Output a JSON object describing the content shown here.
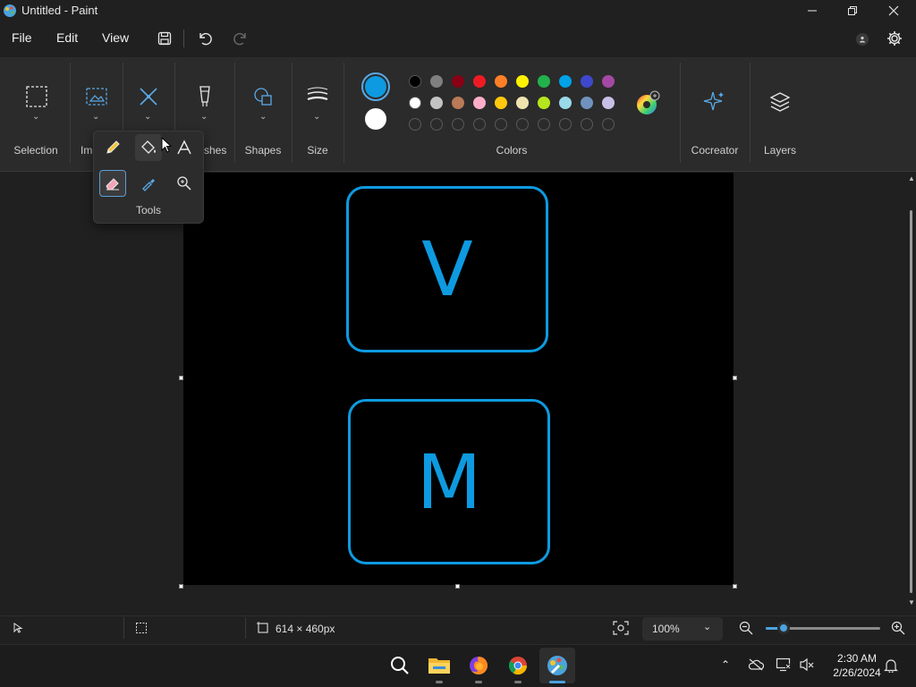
{
  "window": {
    "title": "Untitled - Paint"
  },
  "menu": {
    "file": "File",
    "edit": "Edit",
    "view": "View"
  },
  "ribbon": {
    "groups": {
      "selection": "Selection",
      "image_partial": "Im",
      "brushes_partial": "shes",
      "shapes": "Shapes",
      "size": "Size",
      "colors": "Colors",
      "cocreator": "Cocreator",
      "layers": "Layers"
    },
    "colors": {
      "primary": "#0e9ae0",
      "secondary": "#ffffff",
      "row1": [
        "#000000",
        "#7f7f7f",
        "#880015",
        "#ed1c24",
        "#ff7f27",
        "#fff200",
        "#22b14c",
        "#00a2e8",
        "#3f48cc",
        "#a349a4"
      ],
      "row2": [
        "#ffffff",
        "#c3c3c3",
        "#b97a57",
        "#ffaec9",
        "#ffc90e",
        "#efe4b0",
        "#b5e61d",
        "#99d9ea",
        "#7092be",
        "#c8bfe7"
      ]
    }
  },
  "tools_popup": {
    "label": "Tools"
  },
  "canvas": {
    "letters": [
      "V",
      "M"
    ],
    "stroke_color": "#0e9ae0",
    "background": "#000000"
  },
  "status": {
    "canvas_size": "614 × 460px",
    "zoom": "100%",
    "zoom_slider_fraction": 0.16
  },
  "taskbar": {
    "time": "2:30 AM",
    "date": "2/26/2024"
  }
}
